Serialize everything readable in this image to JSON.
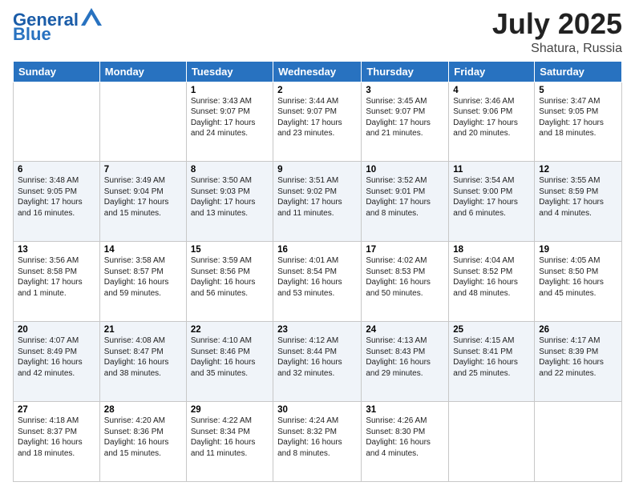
{
  "header": {
    "logo_text_general": "General",
    "logo_text_blue": "Blue",
    "title": "July 2025",
    "location": "Shatura, Russia"
  },
  "days_of_week": [
    "Sunday",
    "Monday",
    "Tuesday",
    "Wednesday",
    "Thursday",
    "Friday",
    "Saturday"
  ],
  "weeks": [
    [
      {
        "day": "",
        "info": ""
      },
      {
        "day": "",
        "info": ""
      },
      {
        "day": "1",
        "info": "Sunrise: 3:43 AM\nSunset: 9:07 PM\nDaylight: 17 hours and 24 minutes."
      },
      {
        "day": "2",
        "info": "Sunrise: 3:44 AM\nSunset: 9:07 PM\nDaylight: 17 hours and 23 minutes."
      },
      {
        "day": "3",
        "info": "Sunrise: 3:45 AM\nSunset: 9:07 PM\nDaylight: 17 hours and 21 minutes."
      },
      {
        "day": "4",
        "info": "Sunrise: 3:46 AM\nSunset: 9:06 PM\nDaylight: 17 hours and 20 minutes."
      },
      {
        "day": "5",
        "info": "Sunrise: 3:47 AM\nSunset: 9:05 PM\nDaylight: 17 hours and 18 minutes."
      }
    ],
    [
      {
        "day": "6",
        "info": "Sunrise: 3:48 AM\nSunset: 9:05 PM\nDaylight: 17 hours and 16 minutes."
      },
      {
        "day": "7",
        "info": "Sunrise: 3:49 AM\nSunset: 9:04 PM\nDaylight: 17 hours and 15 minutes."
      },
      {
        "day": "8",
        "info": "Sunrise: 3:50 AM\nSunset: 9:03 PM\nDaylight: 17 hours and 13 minutes."
      },
      {
        "day": "9",
        "info": "Sunrise: 3:51 AM\nSunset: 9:02 PM\nDaylight: 17 hours and 11 minutes."
      },
      {
        "day": "10",
        "info": "Sunrise: 3:52 AM\nSunset: 9:01 PM\nDaylight: 17 hours and 8 minutes."
      },
      {
        "day": "11",
        "info": "Sunrise: 3:54 AM\nSunset: 9:00 PM\nDaylight: 17 hours and 6 minutes."
      },
      {
        "day": "12",
        "info": "Sunrise: 3:55 AM\nSunset: 8:59 PM\nDaylight: 17 hours and 4 minutes."
      }
    ],
    [
      {
        "day": "13",
        "info": "Sunrise: 3:56 AM\nSunset: 8:58 PM\nDaylight: 17 hours and 1 minute."
      },
      {
        "day": "14",
        "info": "Sunrise: 3:58 AM\nSunset: 8:57 PM\nDaylight: 16 hours and 59 minutes."
      },
      {
        "day": "15",
        "info": "Sunrise: 3:59 AM\nSunset: 8:56 PM\nDaylight: 16 hours and 56 minutes."
      },
      {
        "day": "16",
        "info": "Sunrise: 4:01 AM\nSunset: 8:54 PM\nDaylight: 16 hours and 53 minutes."
      },
      {
        "day": "17",
        "info": "Sunrise: 4:02 AM\nSunset: 8:53 PM\nDaylight: 16 hours and 50 minutes."
      },
      {
        "day": "18",
        "info": "Sunrise: 4:04 AM\nSunset: 8:52 PM\nDaylight: 16 hours and 48 minutes."
      },
      {
        "day": "19",
        "info": "Sunrise: 4:05 AM\nSunset: 8:50 PM\nDaylight: 16 hours and 45 minutes."
      }
    ],
    [
      {
        "day": "20",
        "info": "Sunrise: 4:07 AM\nSunset: 8:49 PM\nDaylight: 16 hours and 42 minutes."
      },
      {
        "day": "21",
        "info": "Sunrise: 4:08 AM\nSunset: 8:47 PM\nDaylight: 16 hours and 38 minutes."
      },
      {
        "day": "22",
        "info": "Sunrise: 4:10 AM\nSunset: 8:46 PM\nDaylight: 16 hours and 35 minutes."
      },
      {
        "day": "23",
        "info": "Sunrise: 4:12 AM\nSunset: 8:44 PM\nDaylight: 16 hours and 32 minutes."
      },
      {
        "day": "24",
        "info": "Sunrise: 4:13 AM\nSunset: 8:43 PM\nDaylight: 16 hours and 29 minutes."
      },
      {
        "day": "25",
        "info": "Sunrise: 4:15 AM\nSunset: 8:41 PM\nDaylight: 16 hours and 25 minutes."
      },
      {
        "day": "26",
        "info": "Sunrise: 4:17 AM\nSunset: 8:39 PM\nDaylight: 16 hours and 22 minutes."
      }
    ],
    [
      {
        "day": "27",
        "info": "Sunrise: 4:18 AM\nSunset: 8:37 PM\nDaylight: 16 hours and 18 minutes."
      },
      {
        "day": "28",
        "info": "Sunrise: 4:20 AM\nSunset: 8:36 PM\nDaylight: 16 hours and 15 minutes."
      },
      {
        "day": "29",
        "info": "Sunrise: 4:22 AM\nSunset: 8:34 PM\nDaylight: 16 hours and 11 minutes."
      },
      {
        "day": "30",
        "info": "Sunrise: 4:24 AM\nSunset: 8:32 PM\nDaylight: 16 hours and 8 minutes."
      },
      {
        "day": "31",
        "info": "Sunrise: 4:26 AM\nSunset: 8:30 PM\nDaylight: 16 hours and 4 minutes."
      },
      {
        "day": "",
        "info": ""
      },
      {
        "day": "",
        "info": ""
      }
    ]
  ]
}
